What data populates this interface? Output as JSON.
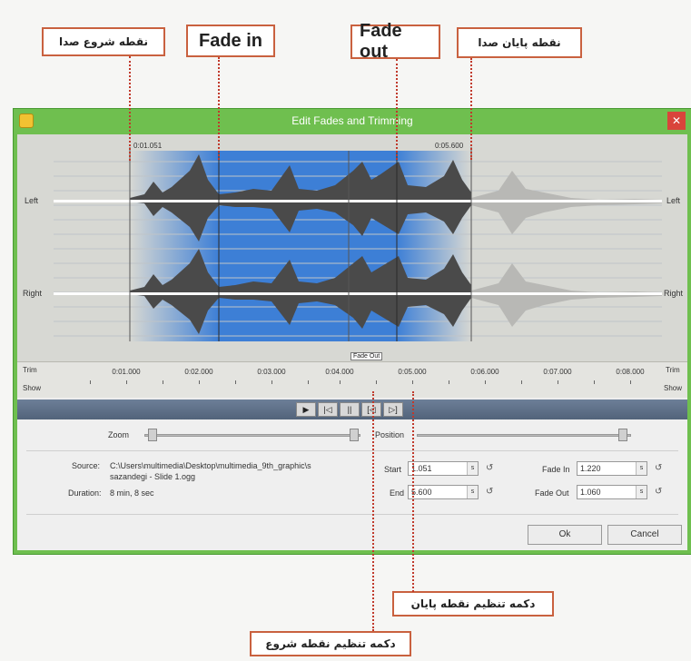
{
  "annotations": {
    "start_point": "نقطه شروع صدا",
    "fade_in": "Fade in",
    "fade_out": "Fade out",
    "end_point": "نقطه پایان صدا",
    "end_button": "دکمه تنظیم نقطه پایان",
    "start_button": "دکمه تنظیم نقطه شروع"
  },
  "window": {
    "title": "Edit Fades and Trimming",
    "close": "✕"
  },
  "waveform": {
    "left_label": "Left",
    "right_label": "Right",
    "start_time": "0:01.051",
    "end_time": "0:05.600",
    "fade_out_tag": "Fade Out"
  },
  "ruler": {
    "trim_label": "Trim",
    "show_label": "Show",
    "ticks": [
      "0:01.000",
      "0:02.000",
      "0:03.000",
      "0:04.000",
      "0:05.000",
      "0:06.000",
      "0:07.000",
      "0:08.000"
    ]
  },
  "transport": {
    "play": "▶",
    "b1": "|◁",
    "b2": "||",
    "b3": "[◁",
    "b4": "▷]"
  },
  "controls": {
    "zoom_label": "Zoom",
    "position_label": "Position",
    "source_label": "Source:",
    "source_value_1": "C:\\Users\\multimedia\\Desktop\\multimedia_9th_graphic\\s",
    "source_value_2": "sazandegi - Slide 1.ogg",
    "duration_label": "Duration:",
    "duration_value": "8 min, 8 sec",
    "start_label": "Start",
    "start_value": "1.051",
    "end_label": "End",
    "end_value": "5.600",
    "fade_in_label": "Fade In",
    "fade_in_value": "1.220",
    "fade_out_label": "Fade Out",
    "fade_out_value": "1.060",
    "unit": "s",
    "reset": "↺",
    "ok": "Ok",
    "cancel": "Cancel"
  },
  "colors": {
    "frame": "#6fbf4f",
    "selection": "#3d7fd6",
    "callout_border": "#c9613f"
  }
}
